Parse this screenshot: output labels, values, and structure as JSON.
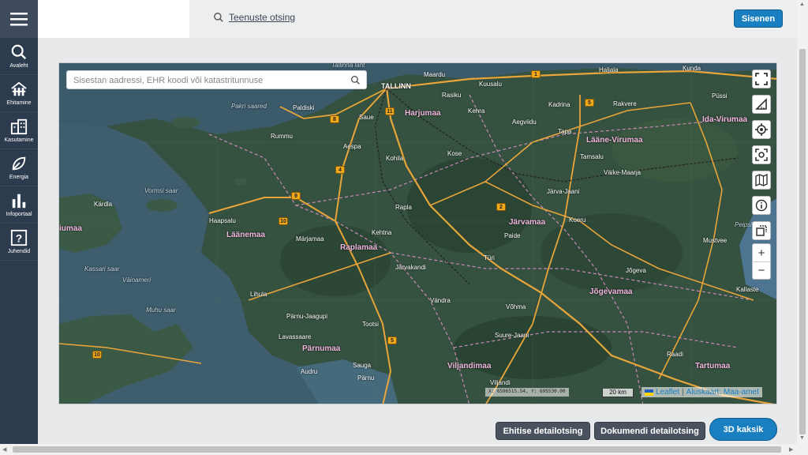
{
  "sidebar": {
    "items": [
      {
        "label": "Avaleht",
        "icon": "search-icon"
      },
      {
        "label": "Ehitamine",
        "icon": "building-icon"
      },
      {
        "label": "Kasutamine",
        "icon": "house-icon"
      },
      {
        "label": "Energia",
        "icon": "leaf-icon"
      },
      {
        "label": "Infoportaal",
        "icon": "bar-chart-icon"
      },
      {
        "label": "Juhendid",
        "icon": "question-icon"
      }
    ]
  },
  "header": {
    "search_link": "Teenuste otsing",
    "login_button": "Sisenen"
  },
  "map": {
    "search_placeholder": "Sisestan aadressi, EHR koodi või katastritunnuse",
    "coordinates": "X: 6596515.54, Y: 695530.00",
    "scale": "20 km",
    "attribution_leaflet": "Leaflet",
    "attribution_sep": "|",
    "attribution_base": "Aluskaart: Maa-amet",
    "labels": {
      "tallinn": "TALLINN",
      "maardu": "Maardu",
      "kuusalu": "Kuusalu",
      "haljala": "Haljala",
      "kunda": "Kunda",
      "rakvere": "Rakvere",
      "kadrina": "Kadrina",
      "pussi": "Püssi",
      "ida_virumaa": "Ida-Virumaa",
      "harjumaa": "Harjumaa",
      "rasiku": "Rasiku",
      "kehra": "Kehra",
      "aegviidu": "Aegviidu",
      "tapa": "Tapa",
      "paldiski": "Paldiski",
      "pakri": "Pakri saared",
      "saue": "Saue",
      "rummu": "Rummu",
      "aespa": "Aespa",
      "kohila": "Kohila",
      "kose": "Kose",
      "laane_virumaa": "Lääne-Virumaa",
      "tamsalu": "Tamsalu",
      "vaike_maarja": "Väike-Maarja",
      "vormsi": "Vormsi saar",
      "karala": "Kärdla",
      "haapsalu": "Haapsalu",
      "laanemaa": "Läänemaa",
      "rapla": "Rapla",
      "kehtna": "Kehtna",
      "marjamaa": "Märjamaa",
      "raplamaa": "Raplamaa",
      "jarva_jaani": "Järva-Jaani",
      "koeru": "Koeru",
      "jarvamaa": "Järvamaa",
      "paide": "Paide",
      "peipsi": "Peipsi",
      "mustvee": "Mustvee",
      "turi": "Türi",
      "jarvakandi": "Järvakandi",
      "hiiumaa": "Hiiumaa",
      "kassari": "Kassari saar",
      "vainameri": "Väinameri",
      "jogeva": "Jõgeva",
      "jogevamaa": "Jõgevamaa",
      "lihula": "Lihula",
      "vandra": "Vändra",
      "vohma": "Võhma",
      "kallaste": "Kallaste",
      "muhu": "Muhu saar",
      "parnu_jaagupi": "Pärnu-Jaagupi",
      "tootsi": "Tootsi",
      "suure_jaani": "Suure-Jaani",
      "lavassaare": "Lavassaare",
      "parnumaa": "Pärnumaa",
      "sauga": "Sauga",
      "audru": "Audru",
      "parnu": "Pärnu",
      "viljandimaa": "Viljandimaa",
      "viljandi": "Viljandi",
      "tartumaa": "Tartumaa",
      "raadi": "Raadi",
      "tallinna_laht": "Tallinna laht"
    },
    "roads": [
      "1",
      "5",
      "8",
      "11",
      "4",
      "9",
      "10",
      "2",
      "5",
      "10"
    ]
  },
  "buttons": {
    "ehitise": "Ehitise detailotsing",
    "dokumendi": "Dokumendi detailotsing",
    "kaksik": "3D kaksik"
  }
}
